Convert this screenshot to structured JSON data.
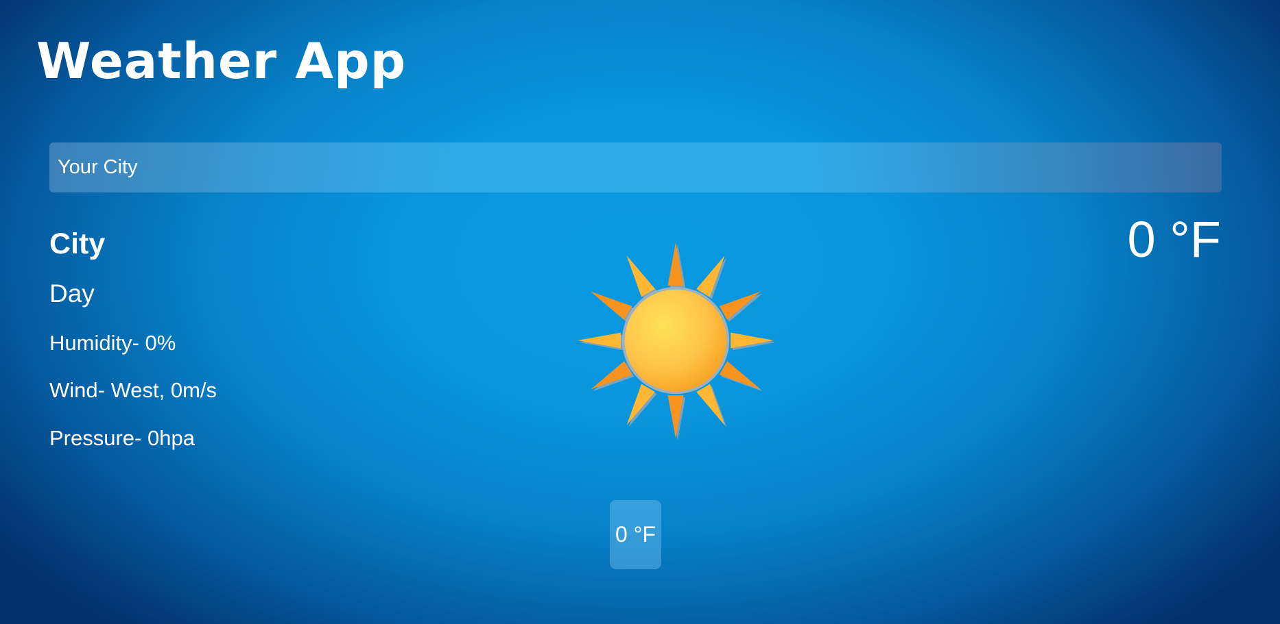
{
  "app": {
    "title": "Weather App"
  },
  "search": {
    "placeholder": "Your City"
  },
  "current": {
    "city": "City",
    "day": "Day",
    "humidity": "Humidity- 0%",
    "wind": "Wind- West, 0m/s",
    "pressure": "Pressure- 0hpa",
    "temperature": "0 °F",
    "condition_icon": "sun-icon"
  },
  "forecast": [
    {
      "temperature": "0 °F"
    }
  ],
  "colors": {
    "background_center": "#0899e0",
    "background_edge": "#03306a",
    "text": "#ffffff",
    "sun_core": "#ffc84a",
    "sun_rays": "#f7931e"
  }
}
